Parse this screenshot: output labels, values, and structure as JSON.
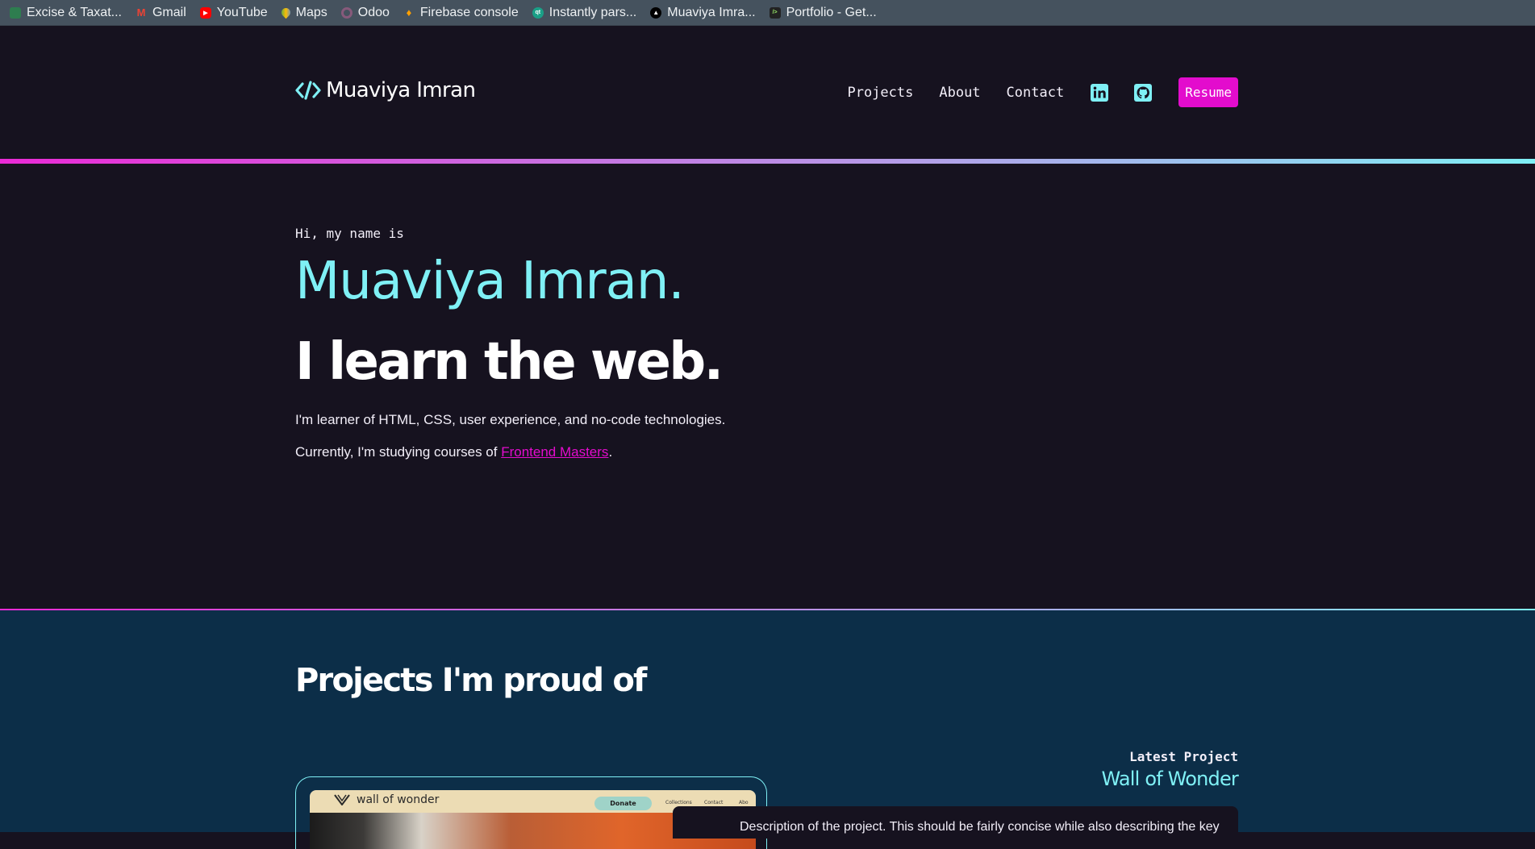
{
  "bookmarks": [
    {
      "label": "Excise & Taxat...",
      "icon": "excise-icon",
      "color": "#2e7d4f"
    },
    {
      "label": "Gmail",
      "icon": "gmail-icon",
      "color": "#ea4335"
    },
    {
      "label": "YouTube",
      "icon": "youtube-icon",
      "color": "#ff0000"
    },
    {
      "label": "Maps",
      "icon": "maps-icon",
      "color": "#34a853"
    },
    {
      "label": "Odoo",
      "icon": "odoo-icon",
      "color": "#875a7b"
    },
    {
      "label": "Firebase console",
      "icon": "firebase-icon",
      "color": "#ffa000"
    },
    {
      "label": "Instantly pars...",
      "icon": "instantly-icon",
      "color": "#1aa087"
    },
    {
      "label": "Muaviya Imra...",
      "icon": "triangle-icon",
      "color": "#000000"
    },
    {
      "label": "Portfolio - Get...",
      "icon": "code-icon",
      "color": "#222222"
    }
  ],
  "header": {
    "logo_text": "Muaviya Imran",
    "nav": [
      "Projects",
      "About",
      "Contact"
    ],
    "resume_label": "Resume"
  },
  "hero": {
    "greeting": "Hi, my name is",
    "name": "Muaviya Imran.",
    "tagline": "I learn the web.",
    "intro": "I'm learner of HTML, CSS, user experience, and no-code technologies.",
    "study_prefix": "Currently, I'm studying courses of ",
    "study_link": "Frontend Masters",
    "study_suffix": "."
  },
  "projects": {
    "title": "Projects I'm proud of",
    "latest_label": "Latest Project",
    "latest_title": "Wall of Wonder",
    "description": "Description of the project. This should be fairly concise while also describing the key",
    "screenshot": {
      "logo": "wall of wonder",
      "donate": "Donate",
      "nav": [
        "Collections",
        "Contact",
        "Abo"
      ]
    }
  },
  "colors": {
    "accent_cyan": "#7ff0f5",
    "accent_magenta": "#e30ccd",
    "background": "#16121f",
    "projects_bg": "#0c2e48"
  }
}
